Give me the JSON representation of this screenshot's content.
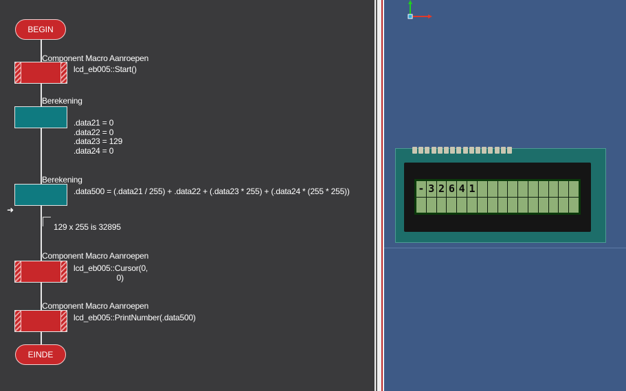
{
  "flowchart": {
    "begin_label": "BEGIN",
    "end_label": "EINDE",
    "icons": [
      {
        "type": "macro",
        "title": "Component Macro Aanroepen",
        "detail": "lcd_eb005::Start()"
      },
      {
        "type": "calc",
        "title": "Berekening",
        "detail": ".data21 = 0\n.data22 = 0\n.data23 = 129\n.data24 = 0"
      },
      {
        "type": "calc",
        "title": "Berekening",
        "detail": ".data500 = (.data21 / 255) + .data22 + (.data23 * 255) + (.data24 * (255 * 255))"
      },
      {
        "type": "macro",
        "title": "Component Macro Aanroepen",
        "detail": "lcd_eb005::Cursor(0,\n                    0)"
      },
      {
        "type": "macro",
        "title": "Component Macro Aanroepen",
        "detail": "lcd_eb005::PrintNumber(.data500)"
      }
    ],
    "comment": "129 x 255 is 32895",
    "cursor_arrow": "➜"
  },
  "simulation": {
    "lcd": {
      "row1": [
        "-",
        "3",
        "2",
        "6",
        "4",
        "1",
        "",
        "",
        "",
        "",
        "",
        "",
        "",
        "",
        "",
        ""
      ],
      "row2": [
        "",
        "",
        "",
        "",
        "",
        "",
        "",
        "",
        "",
        "",
        "",
        "",
        "",
        "",
        "",
        ""
      ]
    }
  },
  "colors": {
    "macro_red": "#c8272a",
    "calc_teal": "#0f7a80",
    "flow_background": "#3a3a3c",
    "sim_background": "#3e5a86",
    "lcd_green": "#8fb077"
  }
}
